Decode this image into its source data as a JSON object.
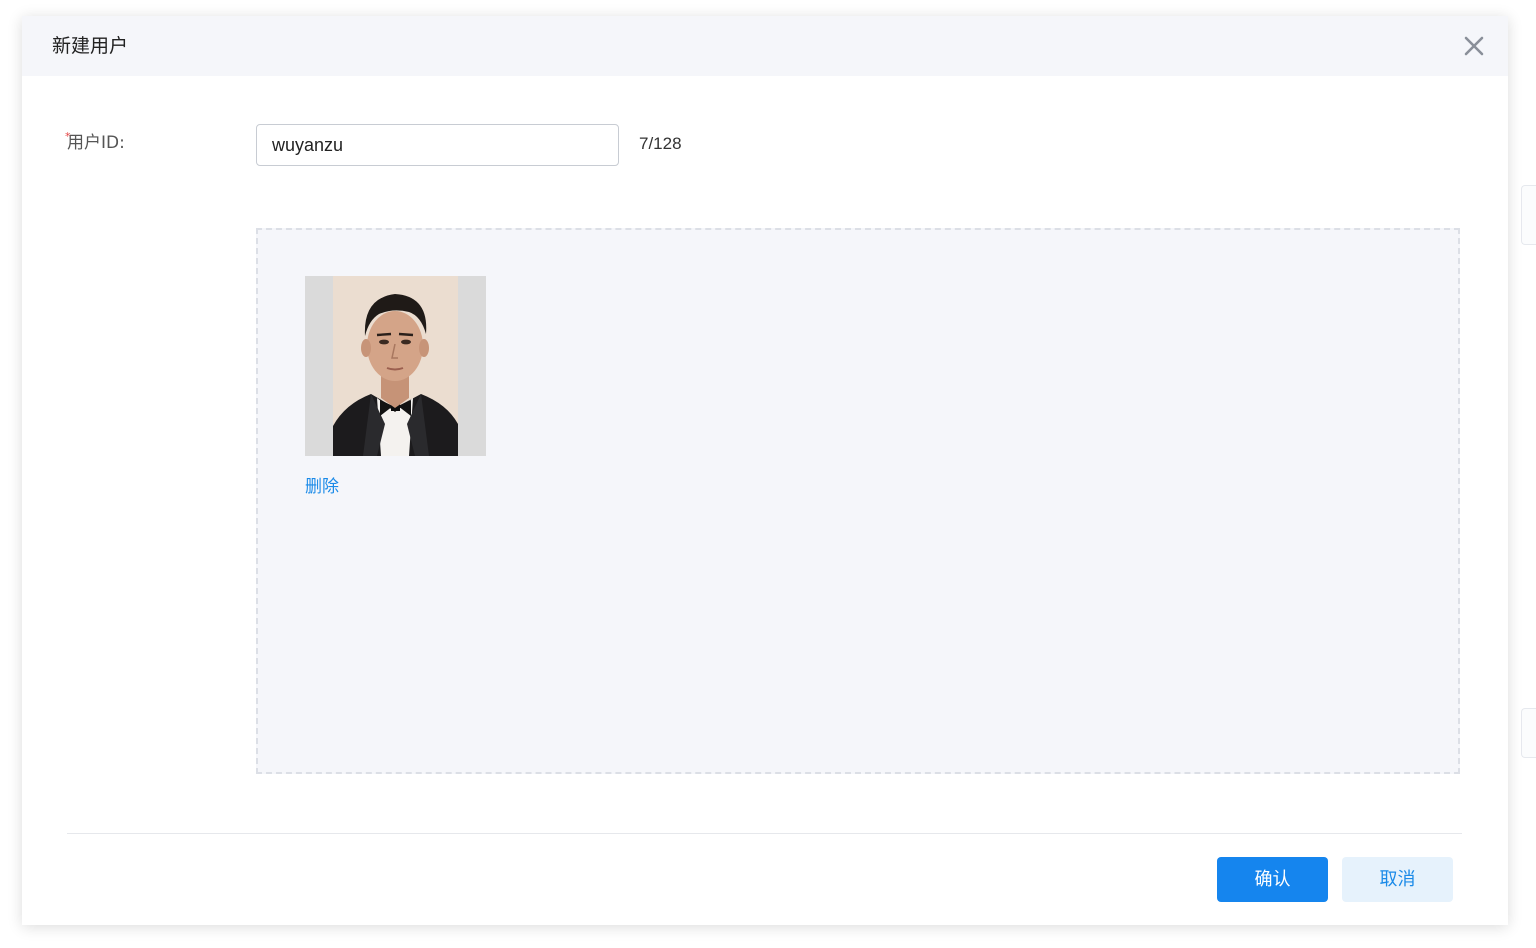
{
  "dialog": {
    "title": "新建用户",
    "close_icon": "close-icon"
  },
  "form": {
    "user_id_label": "用户ID:",
    "required_mark": "*",
    "user_id_value": "wuyanzu",
    "char_counter": "7/128"
  },
  "upload": {
    "photo_alt": "portrait-photo",
    "delete_label": "删除"
  },
  "footer": {
    "confirm_label": "确认",
    "cancel_label": "取消"
  },
  "colors": {
    "primary": "#1585ee",
    "link": "#1a8ae8",
    "header_bg": "#f5f6fa",
    "required": "#e54545"
  }
}
